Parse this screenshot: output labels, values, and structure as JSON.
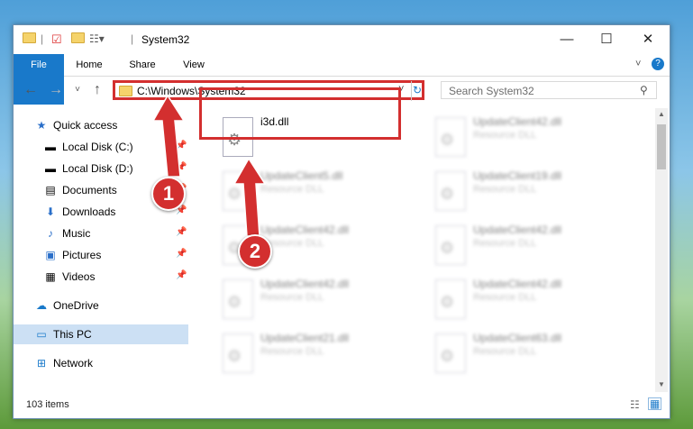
{
  "window": {
    "title": "System32"
  },
  "controls": {
    "minimize": "—",
    "maximize": "☐",
    "close": "✕"
  },
  "ribbon": {
    "tabs": [
      "File",
      "Home",
      "Share",
      "View"
    ]
  },
  "address": {
    "path": "C:\\Windows\\System32"
  },
  "search": {
    "placeholder": "Search System32"
  },
  "sidebar": {
    "items": [
      {
        "label": "Quick access",
        "icon": "star-icon",
        "pinned": false
      },
      {
        "label": "Local Disk (C:)",
        "icon": "drive-icon",
        "pinned": true
      },
      {
        "label": "Local Disk (D:)",
        "icon": "drive-icon",
        "pinned": true
      },
      {
        "label": "Documents",
        "icon": "documents-icon",
        "pinned": true
      },
      {
        "label": "Downloads",
        "icon": "download-icon",
        "pinned": true
      },
      {
        "label": "Music",
        "icon": "music-icon",
        "pinned": true
      },
      {
        "label": "Pictures",
        "icon": "pictures-icon",
        "pinned": true
      },
      {
        "label": "Videos",
        "icon": "videos-icon",
        "pinned": true
      },
      {
        "label": "OneDrive",
        "icon": "cloud-icon",
        "pinned": false
      },
      {
        "label": "This PC",
        "icon": "computer-icon",
        "pinned": false,
        "selected": true
      },
      {
        "label": "Network",
        "icon": "network-icon",
        "pinned": false
      }
    ]
  },
  "files": [
    {
      "name": "i3d.dll",
      "desc": ""
    },
    {
      "name": "UpdateClient42.dll",
      "desc": "Resource DLL"
    },
    {
      "name": "UpdateClient5.dll",
      "desc": "Resource DLL"
    },
    {
      "name": "UpdateClient19.dll",
      "desc": "Resource DLL"
    },
    {
      "name": "UpdateClient42.dll",
      "desc": "Resource DLL"
    },
    {
      "name": "UpdateClient42.dll",
      "desc": "Resource DLL"
    },
    {
      "name": "UpdateClient42.dll",
      "desc": "Resource DLL"
    },
    {
      "name": "UpdateClient42.dll",
      "desc": "Resource DLL"
    },
    {
      "name": "UpdateClient21.dll",
      "desc": "Resource DLL"
    },
    {
      "name": "UpdateClient63.dll",
      "desc": "Resource DLL"
    }
  ],
  "status": {
    "count": "103 items"
  },
  "annotations": {
    "step1": "1",
    "step2": "2"
  },
  "colors": {
    "accent": "#1979ca",
    "highlight": "#d32f2f"
  }
}
